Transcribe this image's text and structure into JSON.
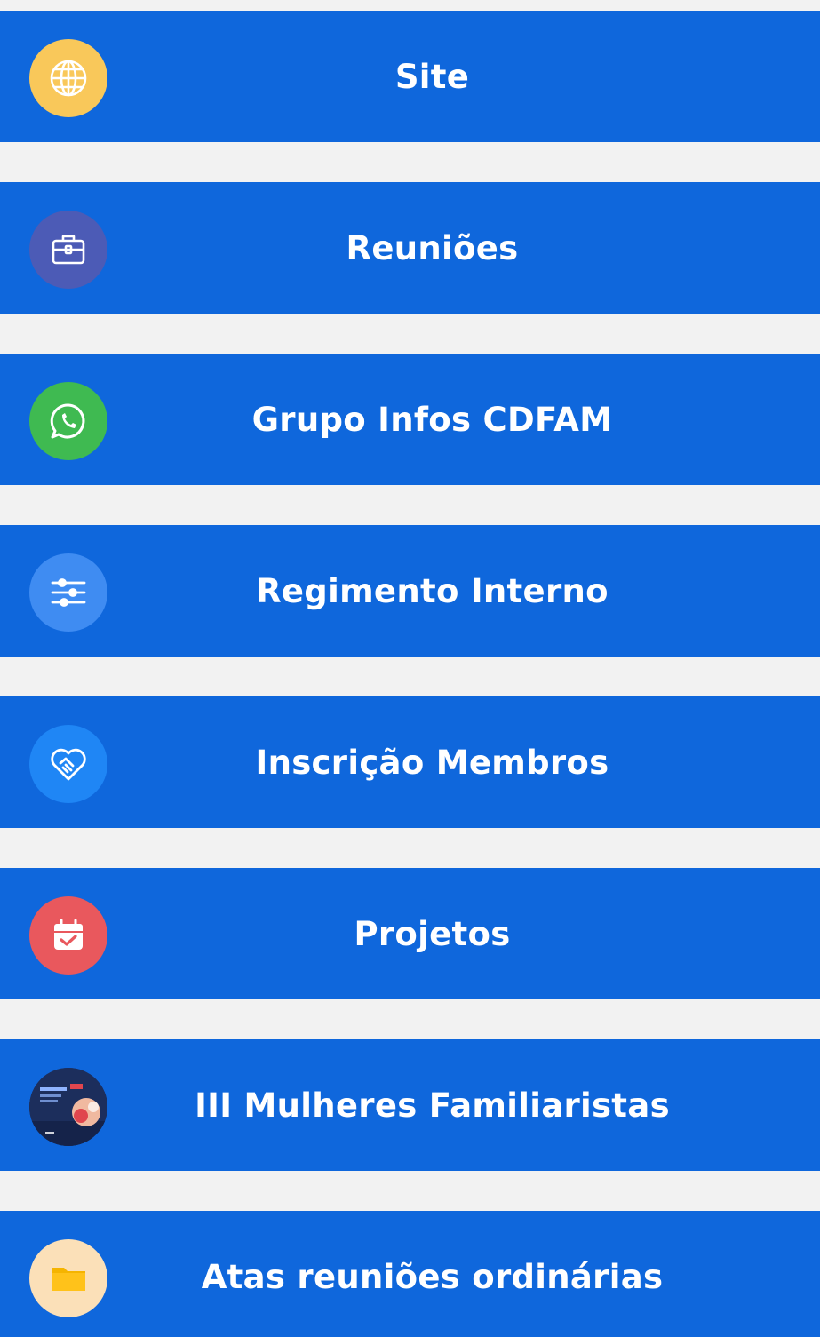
{
  "links": [
    {
      "label": "Site",
      "icon": "globe-icon",
      "icon_bg": "#f9c85a"
    },
    {
      "label": "Reuniões",
      "icon": "briefcase-icon",
      "icon_bg": "#4c5bb6"
    },
    {
      "label": "Grupo Infos CDFAM",
      "icon": "whatsapp-icon",
      "icon_bg": "#3fba51"
    },
    {
      "label": "Regimento Interno",
      "icon": "sliders-icon",
      "icon_bg": "#3f8cf2"
    },
    {
      "label": "Inscrição Membros",
      "icon": "heart-handshake-icon",
      "icon_bg": "#1f86f5"
    },
    {
      "label": "Projetos",
      "icon": "calendar-check-icon",
      "icon_bg": "#e9585d"
    },
    {
      "label": "III Mulheres Familiaristas",
      "icon": "event-thumbnail-icon",
      "icon_bg": "#1c2e5c"
    },
    {
      "label": "Atas reuniões ordinárias",
      "icon": "folder-icon",
      "icon_bg": "#fbe0b8"
    }
  ],
  "colors": {
    "button_bg": "#0f67dc",
    "page_bg": "#f2f2f2",
    "text": "#ffffff"
  }
}
